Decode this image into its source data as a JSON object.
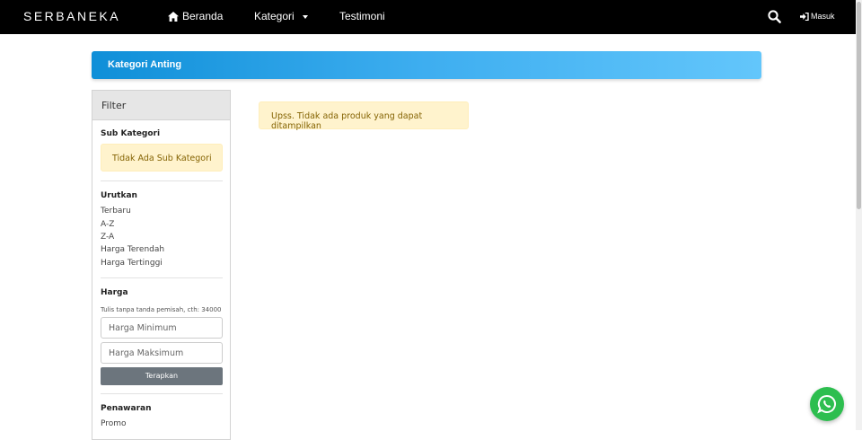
{
  "navbar": {
    "brand": "SERBANEKA",
    "links": [
      {
        "label": "Beranda",
        "icon": "home-icon"
      },
      {
        "label": "Kategori",
        "icon": "caret-down-icon"
      },
      {
        "label": "Testimoni"
      }
    ],
    "search_icon": "search-icon",
    "login_label": "Masuk",
    "login_icon": "sign-in-icon"
  },
  "banner": {
    "title": "Kategori Anting",
    "gradient_colors": [
      "#0f8fd8",
      "#63c6fb"
    ]
  },
  "filter": {
    "title": "Filter",
    "sub_kategori": {
      "title": "Sub Kategori",
      "empty_message": "Tidak Ada Sub Kategori"
    },
    "urutkan": {
      "title": "Urutkan",
      "options": [
        "Terbaru",
        "A-Z",
        "Z-A",
        "Harga Terendah",
        "Harga Tertinggi"
      ]
    },
    "harga": {
      "title": "Harga",
      "hint": "Tulis tanpa tanda pemisah, cth: 34000",
      "min_placeholder": "Harga Minimum",
      "min_value": "",
      "max_placeholder": "Harga Maksimum",
      "max_value": "",
      "apply_label": "Terapkan"
    },
    "penawaran": {
      "title": "Penawaran",
      "options": [
        "Promo"
      ]
    }
  },
  "main": {
    "empty_message": "Upss. Tidak ada produk yang dapat ditampilkan"
  },
  "whatsapp": {
    "icon": "whatsapp-icon",
    "color": "#2dbe4f"
  }
}
